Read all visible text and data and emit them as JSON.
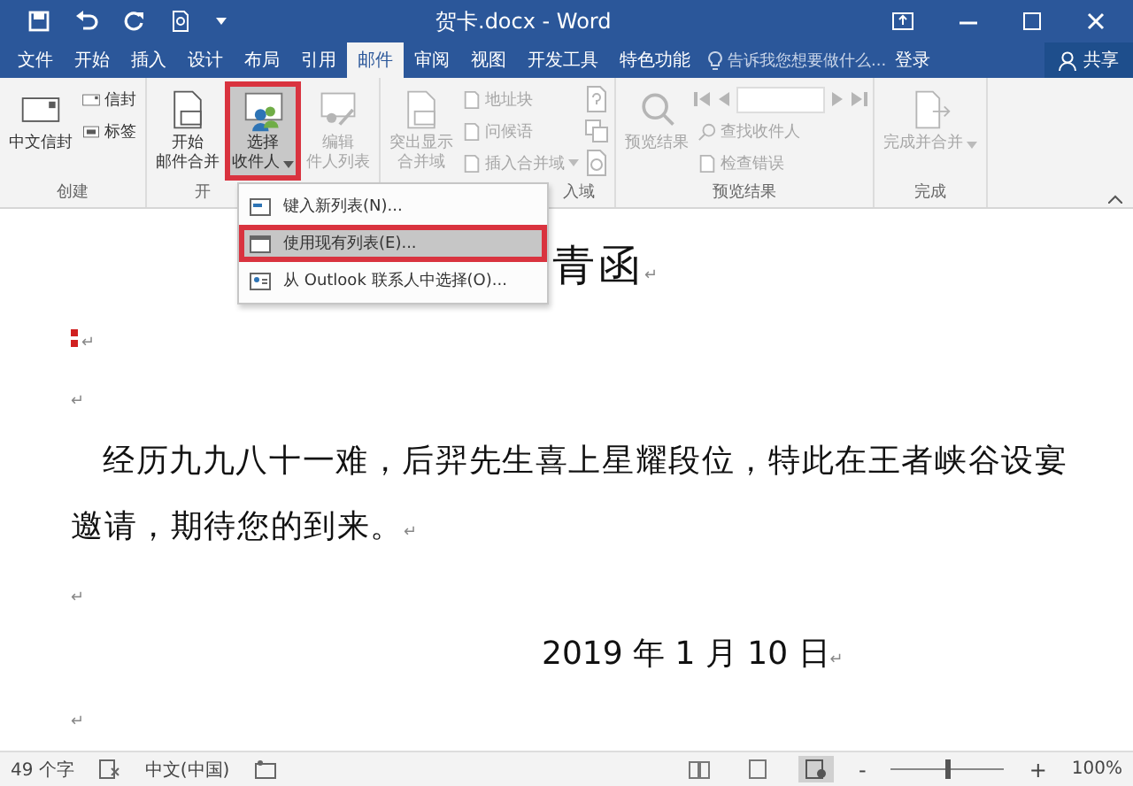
{
  "window": {
    "title": "贺卡.docx - Word"
  },
  "tabs": [
    {
      "label": "文件",
      "selected": false
    },
    {
      "label": "开始",
      "selected": false
    },
    {
      "label": "插入",
      "selected": false
    },
    {
      "label": "设计",
      "selected": false
    },
    {
      "label": "布局",
      "selected": false
    },
    {
      "label": "引用",
      "selected": false
    },
    {
      "label": "邮件",
      "selected": true
    },
    {
      "label": "审阅",
      "selected": false
    },
    {
      "label": "视图",
      "selected": false
    },
    {
      "label": "开发工具",
      "selected": false
    },
    {
      "label": "特色功能",
      "selected": false
    }
  ],
  "tell_me": {
    "placeholder": "告诉我您想要做什么..."
  },
  "sign_in": "登录",
  "share": "共享",
  "ribbon": {
    "groups": [
      {
        "label": "创建",
        "columns": [
          {
            "kind": "large",
            "lines": [
              "中文信封"
            ],
            "disabled": false,
            "highlighted": false,
            "dropdown": false
          },
          {
            "kind": "stack",
            "items": [
              {
                "label": "信封",
                "disabled": false,
                "dropdown": false
              },
              {
                "label": "标签",
                "disabled": false,
                "dropdown": false
              }
            ]
          }
        ]
      },
      {
        "label": "开",
        "columns": [
          {
            "kind": "large",
            "lines": [
              "开始",
              "邮件合并"
            ],
            "disabled": false,
            "highlighted": false,
            "dropdown": false
          },
          {
            "kind": "large",
            "lines": [
              "选择",
              "收件人"
            ],
            "disabled": false,
            "highlighted": true,
            "dropdown": true
          },
          {
            "kind": "large",
            "lines": [
              "编辑",
              "件人列表"
            ],
            "disabled": true,
            "highlighted": false,
            "dropdown": false
          }
        ]
      },
      {
        "label": "入域",
        "columns": [
          {
            "kind": "large",
            "lines": [
              "突出显示",
              "合并域"
            ],
            "disabled": true,
            "highlighted": false,
            "dropdown": false
          },
          {
            "kind": "stack",
            "items": [
              {
                "label": "地址块",
                "disabled": true,
                "dropdown": false
              },
              {
                "label": "问候语",
                "disabled": true,
                "dropdown": false
              },
              {
                "label": "插入合并域",
                "disabled": true,
                "dropdown": true
              }
            ]
          },
          {
            "kind": "icons",
            "disabled": true
          }
        ]
      },
      {
        "label": "预览结果",
        "columns": [
          {
            "kind": "large",
            "lines": [
              "预览结果"
            ],
            "disabled": true,
            "highlighted": false,
            "dropdown": false
          },
          {
            "kind": "nav",
            "disabled": true,
            "items": [
              {
                "label": "查找收件人",
                "disabled": true,
                "dropdown": false
              },
              {
                "label": "检查错误",
                "disabled": true,
                "dropdown": false
              }
            ]
          }
        ]
      },
      {
        "label": "完成",
        "columns": [
          {
            "kind": "large",
            "lines": [
              "完成并合并"
            ],
            "disabled": true,
            "highlighted": false,
            "dropdown": true
          }
        ]
      }
    ]
  },
  "menu": {
    "items": [
      {
        "label": "键入新列表(N)...",
        "highlighted": false
      },
      {
        "label": "使用现有列表(E)...",
        "highlighted": true
      },
      {
        "label": "从 Outlook 联系人中选择(O)...",
        "highlighted": false
      }
    ]
  },
  "document": {
    "paragraphs": [
      {
        "kind": "title",
        "text": "青函",
        "mark": "↵"
      },
      {
        "kind": "bullet",
        "mark": "↵"
      },
      {
        "kind": "empty",
        "mark": "↵"
      },
      {
        "kind": "body",
        "text": "经历九九八十一难，后羿先生喜上星耀段位，特此在王者峡谷设宴邀请，期待您的到来。",
        "mark": "↵"
      },
      {
        "kind": "empty",
        "mark": "↵"
      },
      {
        "kind": "date",
        "text": "2019 年 1 月 10 日",
        "mark": "↵"
      },
      {
        "kind": "empty",
        "mark": "↵"
      }
    ]
  },
  "status_bar": {
    "word_count": "49 个字",
    "language": "中文(中国)",
    "zoom": {
      "minus": "-",
      "plus": "+",
      "level": 0.5,
      "reading": "100%"
    }
  }
}
